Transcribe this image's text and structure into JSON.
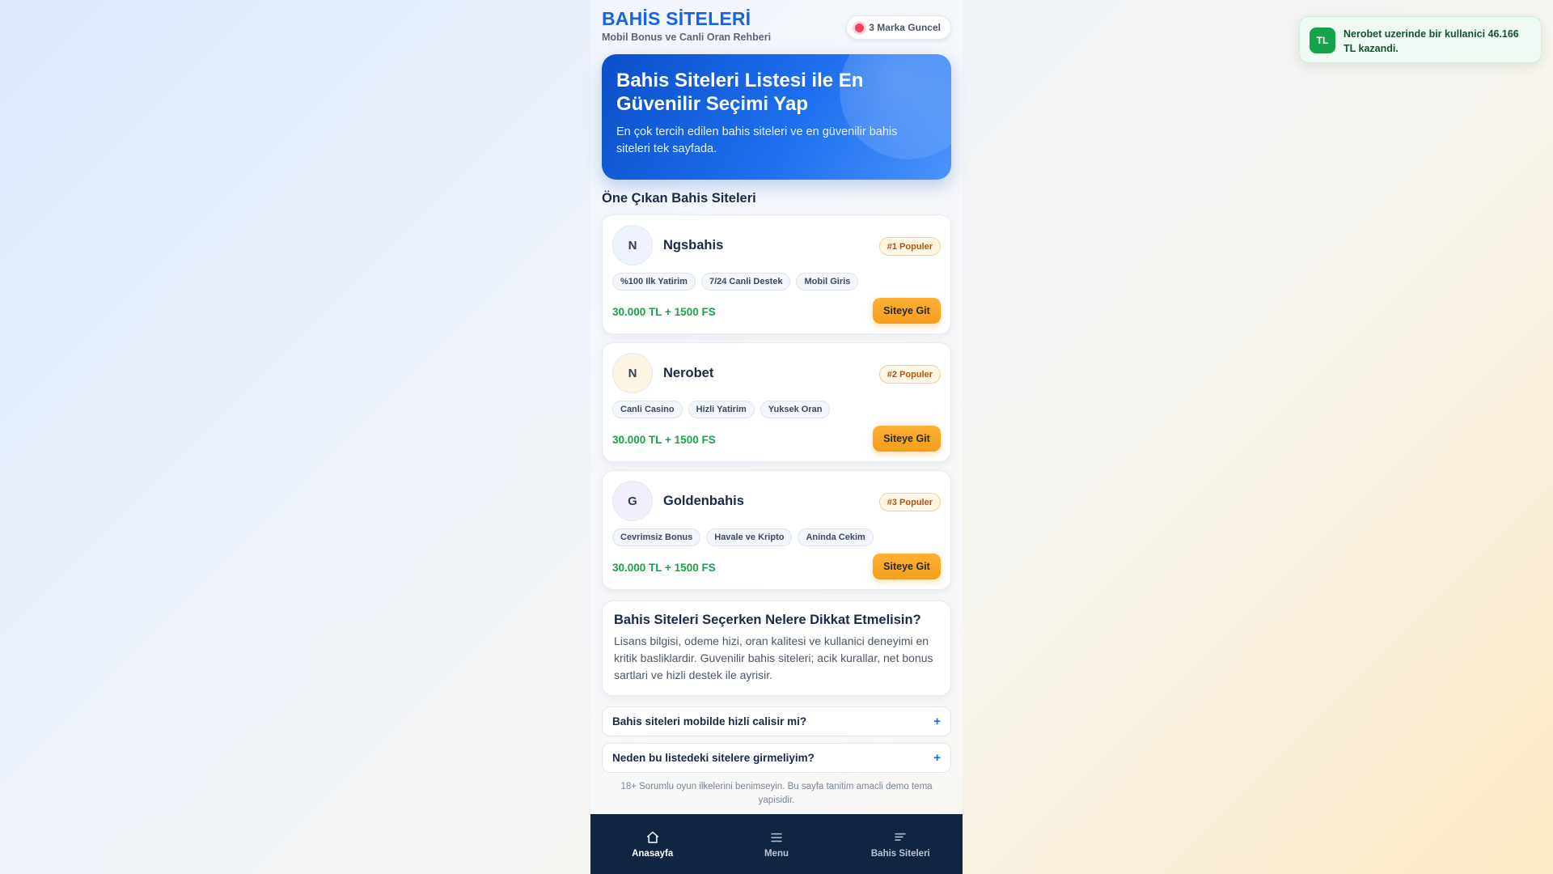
{
  "header": {
    "title": "BAHİS SİTELERİ",
    "subtitle": "Mobil Bonus ve Canli Oran Rehberi",
    "status": "3 Marka Guncel"
  },
  "hero": {
    "title": "Bahis Siteleri Listesi ile En Güvenilir Seçimi Yap",
    "text": "En çok tercih edilen bahis siteleri ve en güvenilir bahis siteleri tek sayfada."
  },
  "section_title": "Öne Çıkan Bahis Siteleri",
  "cards": [
    {
      "initial": "N",
      "name": "Ngsbahis",
      "rank": "#1 Populer",
      "tags": [
        "%100 Ilk Yatirim",
        "7/24 Canli Destek",
        "Mobil Giris"
      ],
      "bonus": "30.000 TL + 1500 FS",
      "button": "Siteye Git",
      "avatar_color": "#eef3fd"
    },
    {
      "initial": "N",
      "name": "Nerobet",
      "rank": "#2 Populer",
      "tags": [
        "Canli Casino",
        "Hizli Yatirim",
        "Yuksek Oran"
      ],
      "bonus": "30.000 TL + 1500 FS",
      "button": "Siteye Git",
      "avatar_color": "#fdf4e3"
    },
    {
      "initial": "G",
      "name": "Goldenbahis",
      "rank": "#3 Populer",
      "tags": [
        "Cevrimsiz Bonus",
        "Havale ve Kripto",
        "Aninda Cekim"
      ],
      "bonus": "30.000 TL + 1500 FS",
      "button": "Siteye Git",
      "avatar_color": "#f3eefc"
    }
  ],
  "info": {
    "title": "Bahis Siteleri Seçerken Nelere Dikkat Etmelisin?",
    "text": "Lisans bilgisi, odeme hizi, oran kalitesi ve kullanici deneyimi en kritik basliklardir. Guvenilir bahis siteleri; acik kurallar, net bonus sartlari ve hizli destek ile ayrisir."
  },
  "faq": [
    {
      "question": "Bahis siteleri mobilde hizli calisir mi?",
      "icon": "+"
    },
    {
      "question": "Neden bu listedeki sitelere girmeliyim?",
      "icon": "+"
    }
  ],
  "footnote": "18+ Sorumlu oyun ilkelerini benimseyin. Bu sayfa tanitim amacli demo tema yapisidir.",
  "nav": [
    {
      "label": "Anasayfa",
      "icon": "home-icon"
    },
    {
      "label": "Menu",
      "icon": "menu-icon"
    },
    {
      "label": "Bahis Siteleri",
      "icon": "list-icon"
    }
  ],
  "toast": {
    "icon_text": "TL",
    "text": "Nerobet uzerinde bir kullanici 46.166 TL kazandi."
  },
  "colors": {
    "brand": "#1565e0",
    "accent": "#f59e1b",
    "bonus": "#16a34a",
    "nav_bg": "#0f2542"
  }
}
